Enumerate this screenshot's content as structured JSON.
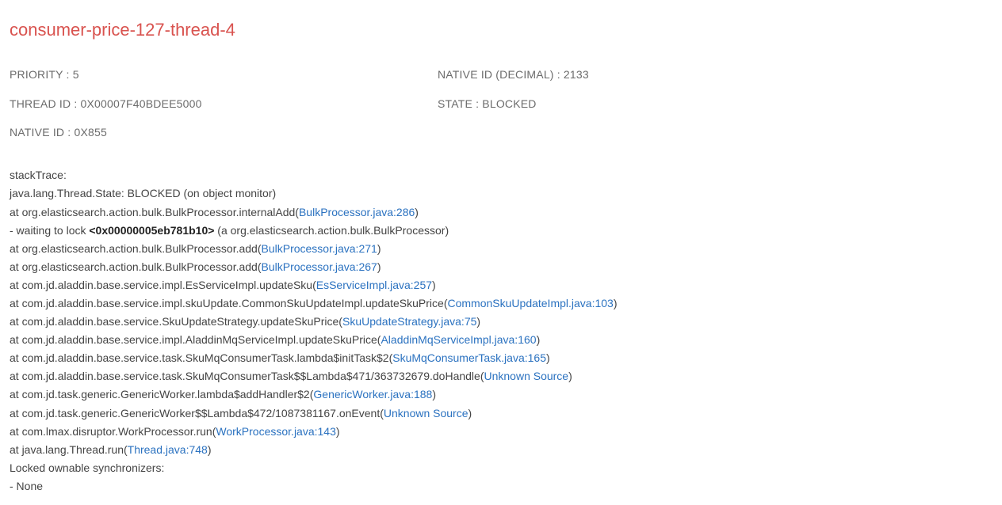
{
  "title": "consumer-price-127-thread-4",
  "meta": {
    "priority_label": "PRIORITY : 5",
    "native_id_dec_label": "NATIVE ID (DECIMAL) : 2133",
    "thread_id_label": "THREAD ID : 0X00007F40BDEE5000",
    "state_label": "STATE : BLOCKED",
    "native_id_label": "NATIVE ID : 0X855"
  },
  "stack": {
    "header": "stackTrace:",
    "state_line": "java.lang.Thread.State: BLOCKED (on object monitor)",
    "frames": [
      {
        "prefix": "at org.elasticsearch.action.bulk.BulkProcessor.internalAdd(",
        "link": "BulkProcessor.java:286",
        "suffix": ")"
      },
      {
        "prefix": "- waiting to lock ",
        "bold": "<0x00000005eb781b10>",
        "suffix": " (a org.elasticsearch.action.bulk.BulkProcessor)"
      },
      {
        "prefix": "at org.elasticsearch.action.bulk.BulkProcessor.add(",
        "link": "BulkProcessor.java:271",
        "suffix": ")"
      },
      {
        "prefix": "at org.elasticsearch.action.bulk.BulkProcessor.add(",
        "link": "BulkProcessor.java:267",
        "suffix": ")"
      },
      {
        "prefix": "at com.jd.aladdin.base.service.impl.EsServiceImpl.updateSku(",
        "link": "EsServiceImpl.java:257",
        "suffix": ")"
      },
      {
        "prefix": "at com.jd.aladdin.base.service.impl.skuUpdate.CommonSkuUpdateImpl.updateSkuPrice(",
        "link": "CommonSkuUpdateImpl.java:103",
        "suffix": ")"
      },
      {
        "prefix": "at com.jd.aladdin.base.service.SkuUpdateStrategy.updateSkuPrice(",
        "link": "SkuUpdateStrategy.java:75",
        "suffix": ")"
      },
      {
        "prefix": "at com.jd.aladdin.base.service.impl.AladdinMqServiceImpl.updateSkuPrice(",
        "link": "AladdinMqServiceImpl.java:160",
        "suffix": ")"
      },
      {
        "prefix": "at com.jd.aladdin.base.service.task.SkuMqConsumerTask.lambda$initTask$2(",
        "link": "SkuMqConsumerTask.java:165",
        "suffix": ")"
      },
      {
        "prefix": "at com.jd.aladdin.base.service.task.SkuMqConsumerTask$$Lambda$471/363732679.doHandle(",
        "link": "Unknown Source",
        "suffix": ")"
      },
      {
        "prefix": "at com.jd.task.generic.GenericWorker.lambda$addHandler$2(",
        "link": "GenericWorker.java:188",
        "suffix": ")"
      },
      {
        "prefix": "at com.jd.task.generic.GenericWorker$$Lambda$472/1087381167.onEvent(",
        "link": "Unknown Source",
        "suffix": ")"
      },
      {
        "prefix": "at com.lmax.disruptor.WorkProcessor.run(",
        "link": "WorkProcessor.java:143",
        "suffix": ")"
      },
      {
        "prefix": "at java.lang.Thread.run(",
        "link": "Thread.java:748",
        "suffix": ")"
      }
    ],
    "locked_sync_header": "Locked ownable synchronizers:",
    "locked_sync_value": "- None"
  }
}
